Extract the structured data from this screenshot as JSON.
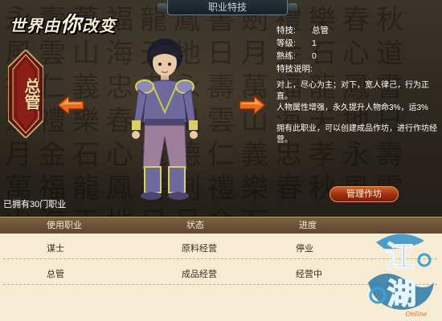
{
  "header": {
    "title": "职业特技",
    "slogan_prefix": "世界由",
    "slogan_big": "你",
    "slogan_suffix": "改变"
  },
  "job": {
    "emblem_text": "总管",
    "info": {
      "skill_label": "特技:",
      "skill_value": "总管",
      "level_label": "等级:",
      "level_value": "1",
      "proficiency_label": "熟练:",
      "proficiency_value": "0",
      "desc_label": "特技说明:",
      "desc_line1": "对上，尽心为主；对下，宽人律己，行为正直。",
      "desc_line2": "人物属性增强，永久提升人物命3%，运3%",
      "desc_line3": "拥有此职业，可以创建成品作坊，进行作坊经营。"
    }
  },
  "owned_text": "已拥有30门职业",
  "manage_button": "管理作坊",
  "table": {
    "headers": [
      "使用职业",
      "状态",
      "进度"
    ],
    "rows": [
      [
        "谋士",
        "原料经营",
        "停业"
      ],
      [
        "总管",
        "成品经营",
        "经营中"
      ]
    ]
  },
  "logo": {
    "text_top": "江",
    "text_bottom": "湖",
    "subtitle": "Online"
  },
  "colors": {
    "accent_orange": "#e0601a",
    "table_bg": "#f6ecd4",
    "header_brown": "#6d5238",
    "button_red": "#9b2e10"
  },
  "icons": [
    "arrow-left-icon",
    "arrow-right-icon",
    "job-emblem-icon",
    "game-logo-icon"
  ]
}
